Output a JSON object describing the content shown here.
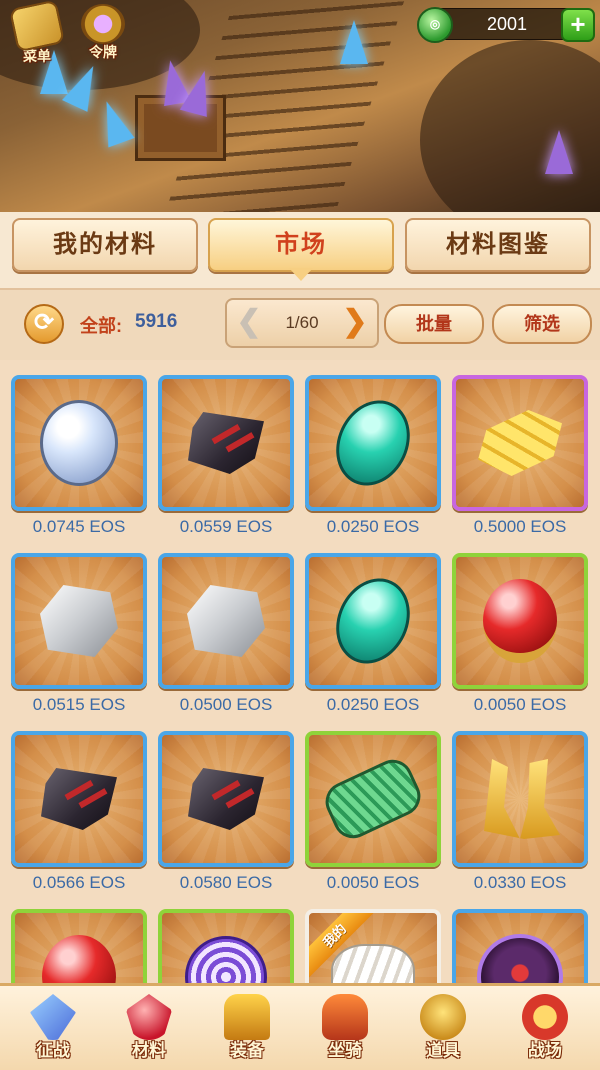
{
  "header": {
    "menu_label": "菜单",
    "token_label": "令牌",
    "currency_value": "2001",
    "currency_icon": "jade-coin-icon",
    "add_icon": "plus-icon"
  },
  "tabs": [
    {
      "label": "我的材料",
      "active": false
    },
    {
      "label": "市场",
      "active": true
    },
    {
      "label": "材料图鉴",
      "active": false
    }
  ],
  "toolbar": {
    "total_label": "全部:",
    "total_value": "5916",
    "page": "1/60",
    "prev_glyph": "❮",
    "next_glyph": "❯",
    "bulk_label": "批量",
    "filter_label": "筛选",
    "refresh_glyph": "⟳"
  },
  "items": [
    {
      "price": "0.0745 EOS",
      "rarity": "blue",
      "icon": "pearl-orb-icon"
    },
    {
      "price": "0.0559 EOS",
      "rarity": "blue",
      "icon": "dark-ore-icon"
    },
    {
      "price": "0.0250 EOS",
      "rarity": "blue",
      "icon": "teal-gem-icon"
    },
    {
      "price": "0.5000 EOS",
      "rarity": "purple",
      "icon": "gold-scales-icon"
    },
    {
      "price": "0.0515 EOS",
      "rarity": "blue",
      "icon": "silver-ore-icon"
    },
    {
      "price": "0.0500 EOS",
      "rarity": "blue",
      "icon": "silver-ore-icon"
    },
    {
      "price": "0.0250 EOS",
      "rarity": "blue",
      "icon": "teal-gem-icon"
    },
    {
      "price": "0.0050 EOS",
      "rarity": "green",
      "icon": "red-orb-icon"
    },
    {
      "price": "0.0566 EOS",
      "rarity": "blue",
      "icon": "dark-ore-icon"
    },
    {
      "price": "0.0580 EOS",
      "rarity": "blue",
      "icon": "dark-ore-icon"
    },
    {
      "price": "0.0050 EOS",
      "rarity": "green",
      "icon": "thread-spool-icon"
    },
    {
      "price": "0.0330 EOS",
      "rarity": "blue",
      "icon": "golden-horns-icon"
    },
    {
      "price": "",
      "rarity": "green",
      "icon": "red-orb-icon"
    },
    {
      "price": "",
      "rarity": "green",
      "icon": "swirl-orb-icon"
    },
    {
      "price": "",
      "rarity": "white",
      "icon": "cloth-bundle-icon",
      "ribbon": "我的"
    },
    {
      "price": "",
      "rarity": "blue",
      "icon": "violet-orb-icon"
    }
  ],
  "bottom_nav": [
    {
      "label": "征战",
      "icon": "swords-icon"
    },
    {
      "label": "材料",
      "icon": "ruby-icon"
    },
    {
      "label": "装备",
      "icon": "armor-icon"
    },
    {
      "label": "坐骑",
      "icon": "mount-icon"
    },
    {
      "label": "道具",
      "icon": "item-bag-icon"
    },
    {
      "label": "战场",
      "icon": "battlefield-icon"
    }
  ]
}
